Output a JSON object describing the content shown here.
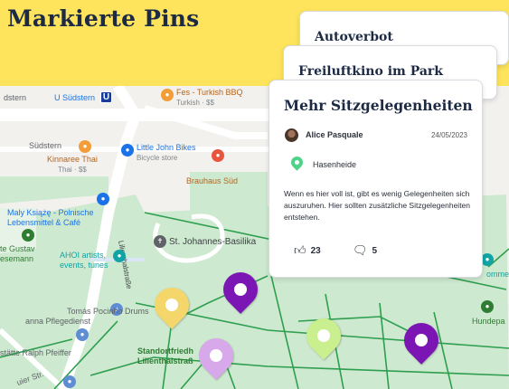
{
  "heading": "Markierte Pins",
  "cards": {
    "back": {
      "title": "Autoverbot"
    },
    "middle": {
      "title": "Freiluftkino im Park"
    },
    "front": {
      "title": "Mehr Sitzgelegenheiten",
      "author": "Alice Pasquale",
      "date": "24/05/2023",
      "location": "Hasenheide",
      "body": "Wenn es hier voll ist, gibt es wenig Gelegenheiten sich auszuruhen. Hier sollten zusätzliche Sitzgelegenheiten entstehen.",
      "likes": "23",
      "comments": "5"
    }
  },
  "map": {
    "labels": {
      "u_suedstern": "U Südstern",
      "ubahn_letter": "U",
      "fes": "Fes - Turkish BBQ",
      "fes_sub": "Turkish · $$",
      "suedstern": "Südstern",
      "kinnaree": "Kinnaree Thai",
      "kinnaree_sub": "Thai · $$",
      "little_john": "Little John Bikes",
      "little_john_sub": "Bicycle store",
      "brauhaus": "Brauhaus Süd",
      "maly": "Maly Książę - Polnische Lebensmittel & Café",
      "maly_1": "Maly Książę - Polnische",
      "maly_2": "Lebensmittel & Café",
      "st_johannes": "St. Johannes-Basilika",
      "lilienthal": "Lilienthalstraße",
      "gustav_1": "te Gustav",
      "gustav_2": "esemann",
      "ahoi_1": "AHOI artists,",
      "ahoi_2": "events, tunes",
      "tomas_1": "Tomás Pocinho Drums",
      "tomas_2": "anna Pflegedienst",
      "ralph": "stätte Ralph Pfeiffer",
      "standort_1": "Standortfriedh",
      "standort_2": "Lilienthalstraß",
      "hundepa": "Hundepa",
      "ommerf": "ommerf",
      "uier": "uier Str."
    }
  },
  "pins": [
    {
      "id": "pin-yellow",
      "color": "#f5d66b"
    },
    {
      "id": "pin-purple-1",
      "color": "#7b16b5"
    },
    {
      "id": "pin-lavender",
      "color": "#d7a8ea"
    },
    {
      "id": "pin-lime",
      "color": "#c9ef8f"
    },
    {
      "id": "pin-purple-2",
      "color": "#7b16b5"
    }
  ],
  "icons": {
    "like": "thumbs-up-icon",
    "comment": "comment-icon",
    "location": "location-pin-icon"
  },
  "colors": {
    "accent_yellow": "#fde45c",
    "park_green": "#cde9cf",
    "path_green": "#2e9e4f",
    "location_green": "#4fd28a"
  }
}
